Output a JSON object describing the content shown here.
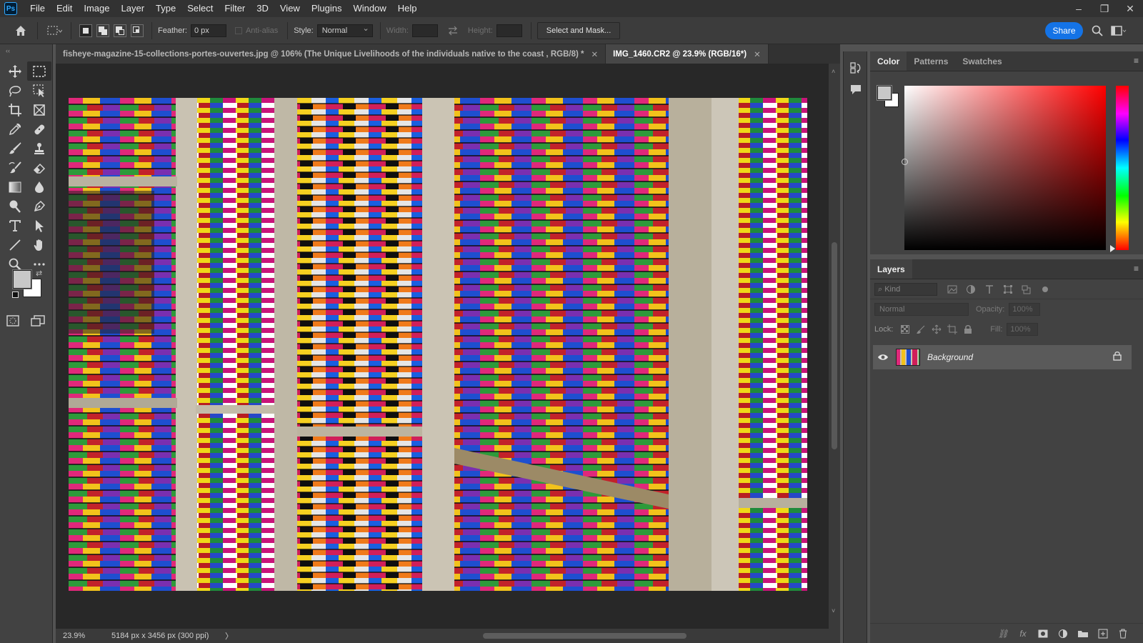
{
  "app": {
    "logo_text": "Ps"
  },
  "menu": {
    "items": [
      "File",
      "Edit",
      "Image",
      "Layer",
      "Type",
      "Select",
      "Filter",
      "3D",
      "View",
      "Plugins",
      "Window",
      "Help"
    ]
  },
  "window_controls": {
    "minimize": "–",
    "restore": "❐",
    "close": "✕"
  },
  "options_bar": {
    "feather_label": "Feather:",
    "feather_value": "0 px",
    "anti_alias_label": "Anti-alias",
    "style_label": "Style:",
    "style_value": "Normal",
    "width_label": "Width:",
    "height_label": "Height:",
    "select_mask_button": "Select and Mask...",
    "share_button": "Share"
  },
  "tabs": [
    {
      "label": "fisheye-magazine-15-collections-portes-ouvertes.jpg @ 106% (The Unique Livelihoods of the individuals native to  the coast , RGB/8) *",
      "close": "✕",
      "active": false
    },
    {
      "label": "IMG_1460.CR2 @ 23.9% (RGB/16*)",
      "close": "✕",
      "active": true
    }
  ],
  "status": {
    "zoom": "23.9%",
    "doc_info": "5184 px x 3456 px (300 ppi)",
    "arrow": "〉"
  },
  "color_panel": {
    "tabs": [
      "Color",
      "Patterns",
      "Swatches"
    ],
    "active_tab": "Color",
    "foreground_color": "#c8c8c8",
    "background_color": "#ffffff",
    "spectrum_hue": "#ff0000"
  },
  "layers_panel": {
    "title": "Layers",
    "filter_kind": "Kind",
    "blend_mode": "Normal",
    "opacity_label": "Opacity:",
    "opacity_value": "100%",
    "lock_label": "Lock:",
    "fill_label": "Fill:",
    "fill_value": "100%",
    "layers": [
      {
        "name": "Background",
        "visible": true,
        "locked": true
      }
    ],
    "footer_fx": "fx"
  },
  "colors": {
    "accent": "#1473e6",
    "panel_bg": "#424242",
    "canvas_bg": "#282828"
  }
}
